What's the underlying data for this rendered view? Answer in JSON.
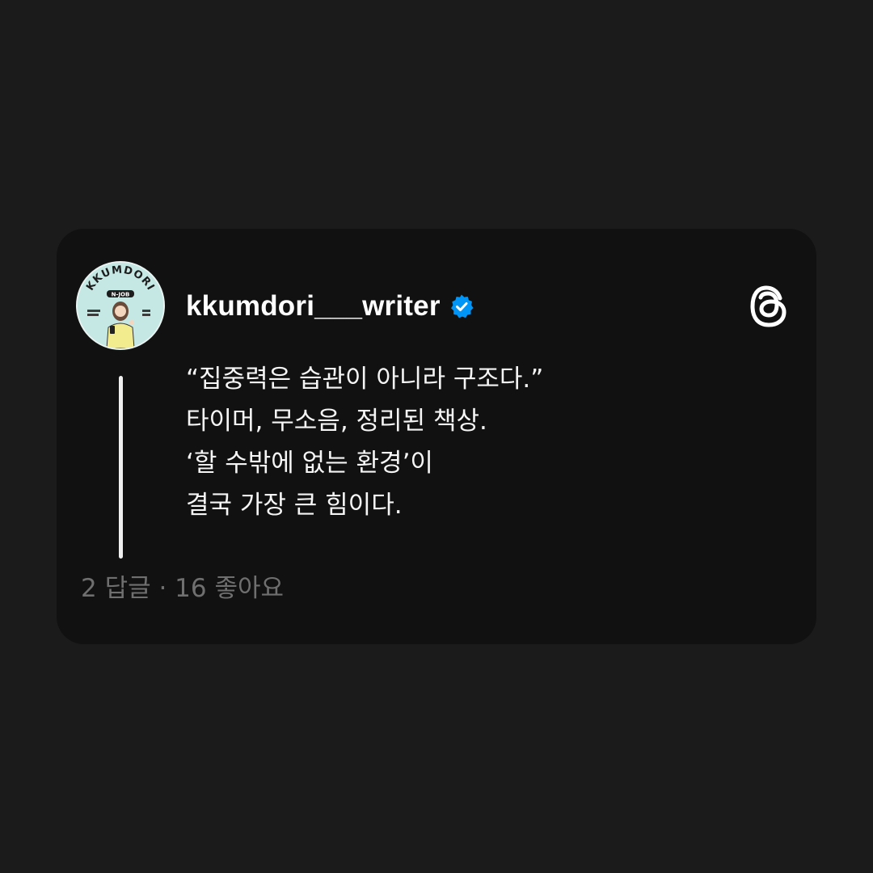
{
  "post": {
    "username": "kkumdori___writer",
    "verified": true,
    "avatar_text_top": "KKUMDORI",
    "avatar_text_sub": "N-JOB",
    "quote_line": "“집중력은 습관이 아니라 구조다.”",
    "body_lines": [
      "타이머, 무소음, 정리된 책상.",
      "‘할 수밖에 없는 환경’이",
      "결국 가장 큰 힘이다."
    ],
    "stats": "2 답글 · 16 좋아요"
  },
  "icons": {
    "verified": "verified-badge-icon",
    "app": "threads-logo-icon"
  },
  "colors": {
    "background": "#1b1b1b",
    "card": "#111111",
    "verified_blue": "#0095f6",
    "meta_text": "#6f6f6f"
  }
}
